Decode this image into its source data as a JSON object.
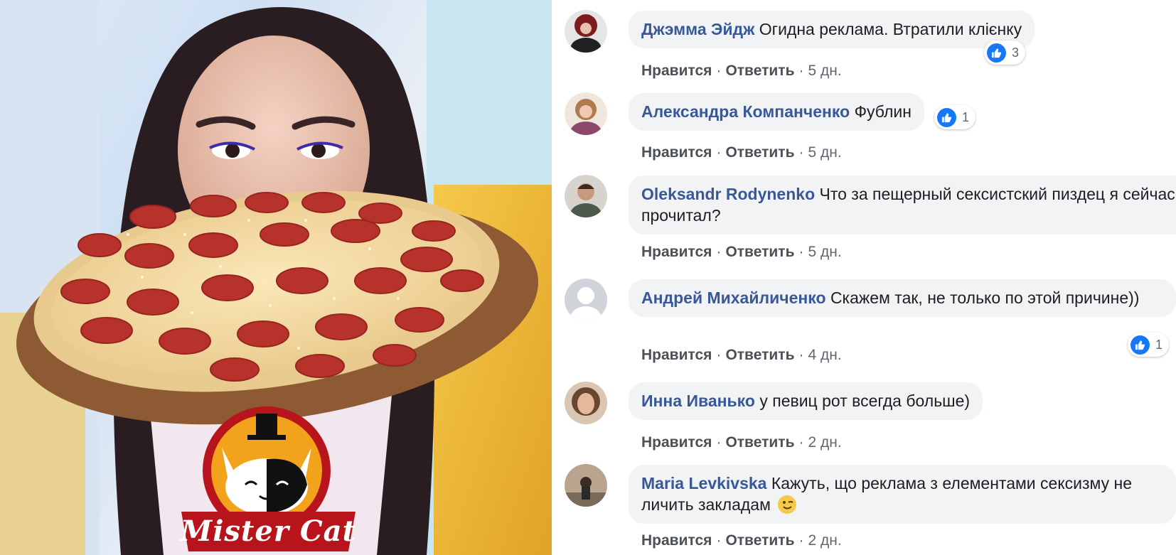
{
  "photo": {
    "logo_text": "Mister Cat"
  },
  "actions": {
    "like": "Нравится",
    "reply": "Ответить",
    "separator": "·"
  },
  "comments": [
    {
      "author": "Джэмма Эйдж",
      "text": "Огидна реклама. Втратили клієнку",
      "time": "5 дн.",
      "likes": "3"
    },
    {
      "author": "Александра Компанченко",
      "text": "Фублин",
      "time": "5 дн.",
      "likes": "1"
    },
    {
      "author": "Oleksandr Rodynenko",
      "text": "Что за пещерный сексистский пиздец я сейчас прочитал?",
      "time": "5 дн."
    },
    {
      "author": "Андрей Михайличенко",
      "text": "Скажем так, не только по этой причине))",
      "time": "4 дн.",
      "likes": "1"
    },
    {
      "author": "Инна Иванько",
      "text": "у певиц рот всегда больше)",
      "time": "2 дн."
    },
    {
      "author": "Maria Levkivska",
      "text": "Кажуть, що реклама з елементами сексизму не личить закладам",
      "time": "2 дн."
    }
  ],
  "icons": {
    "like": "thumbs-up-icon",
    "emoji": "winking-face-emoji"
  },
  "colors": {
    "author_name": "#385898",
    "bubble_bg": "#f2f3f5",
    "like_blue": "#1877f2",
    "logo_red": "#b8141c",
    "logo_orange": "#f2a21b"
  }
}
